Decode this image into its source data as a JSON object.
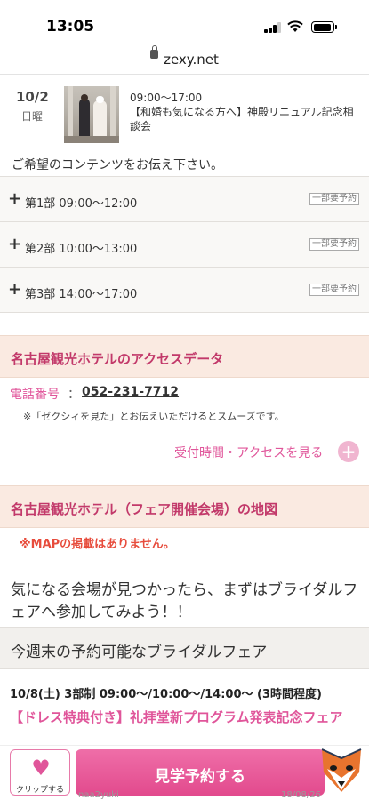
{
  "statusbar": {
    "time": "13:05"
  },
  "browser": {
    "url": "zexy.net"
  },
  "event": {
    "date": "10/2",
    "weekday": "日曜",
    "time": "09:00〜17:00",
    "title": "【和婚も気になる方へ】神殿リニュアル記念相談会"
  },
  "parts_prompt": "ご希望のコンテンツをお伝え下さい。",
  "parts": [
    {
      "label": "第1部  09:00〜12:00",
      "badge": "一部要予約"
    },
    {
      "label": "第2部  10:00〜13:00",
      "badge": "一部要予約"
    },
    {
      "label": "第3部  14:00〜17:00",
      "badge": "一部要予約"
    }
  ],
  "access": {
    "heading": "名古屋観光ホテルのアクセスデータ",
    "tel_label": "電話番号",
    "tel_colon": "：",
    "tel": "052-231-7712",
    "note": "※「ゼクシィを見た」とお伝えいただけるとスムーズです。",
    "more_label": "受付時間・アクセスを見る",
    "more_icon": "+"
  },
  "map": {
    "heading": "名古屋観光ホテル（フェア開催会場）の地図",
    "no_map": "※MAPの掲載はありません。"
  },
  "cta_text": "気になる会場が見つかったら、まずはブライダルフェアへ参加してみよう！！",
  "weekend_heading": "今週末の予約可能なブライダルフェア",
  "fair": {
    "meta": "10/8(土) 3部制 09:00〜/10:00〜/14:00〜 (3時間程度)",
    "title": "【ドレス特典付き】礼拝堂新プログラム発表記念フェア"
  },
  "bottom": {
    "clip_label": "クリップする",
    "reserve_label": "見学予約する",
    "overlay_user": "naa2yuki",
    "overlay_date": "18/08/26"
  },
  "colors": {
    "accent": "#e0559a",
    "heading": "#c2396a",
    "warning": "#e74c3c"
  }
}
